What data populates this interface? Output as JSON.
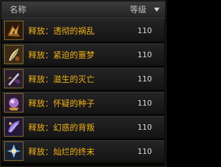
{
  "header": {
    "name_label": "名称",
    "level_label": "等级",
    "sort_icon": "sort-desc-arrow-icon"
  },
  "items": [
    {
      "name": "释放：透彻的祸乱",
      "level": "110",
      "icon": "rift-icon"
    },
    {
      "name": "释放：紧迫的噩梦",
      "level": "110",
      "icon": "feather-nightmare-icon"
    },
    {
      "name": "释放：滋生的灭亡",
      "level": "110",
      "icon": "dark-blade-icon"
    },
    {
      "name": "释放：怀疑的种子",
      "level": "110",
      "icon": "seed-orb-icon"
    },
    {
      "name": "释放：幻惑的背叛",
      "level": "110",
      "icon": "illusion-wing-icon"
    },
    {
      "name": "释放：灿烂的终末",
      "level": "110",
      "icon": "radiant-end-icon"
    }
  ],
  "colors": {
    "item_name": "#f3b21a",
    "level_text": "#e0ddd6",
    "header_text": "#c0c0c0",
    "icon_border": "#8a6a2b"
  }
}
